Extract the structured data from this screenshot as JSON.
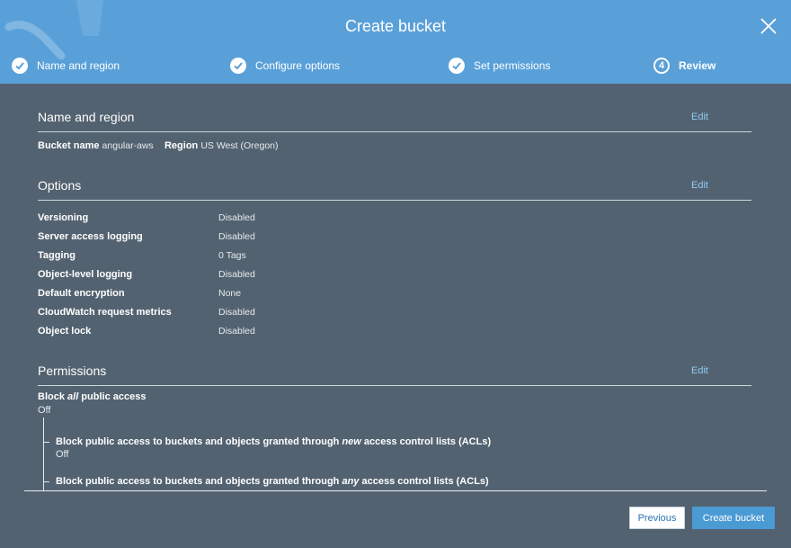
{
  "dialog": {
    "title": "Create bucket"
  },
  "steps": [
    {
      "label": "Name and region",
      "state": "done"
    },
    {
      "label": "Configure options",
      "state": "done"
    },
    {
      "label": "Set permissions",
      "state": "done"
    },
    {
      "number": "4",
      "label": "Review",
      "state": "active"
    }
  ],
  "name_region": {
    "heading": "Name and region",
    "edit": "Edit",
    "bucket_name_label": "Bucket name",
    "bucket_name_value": "angular-aws",
    "region_label": "Region",
    "region_value": "US West (Oregon)"
  },
  "options": {
    "heading": "Options",
    "edit": "Edit",
    "rows": [
      {
        "label": "Versioning",
        "value": "Disabled"
      },
      {
        "label": "Server access logging",
        "value": "Disabled"
      },
      {
        "label": "Tagging",
        "value": "0 Tags"
      },
      {
        "label": "Object-level logging",
        "value": "Disabled"
      },
      {
        "label": "Default encryption",
        "value": "None"
      },
      {
        "label": "CloudWatch request metrics",
        "value": "Disabled"
      },
      {
        "label": "Object lock",
        "value": "Disabled"
      }
    ]
  },
  "permissions": {
    "heading": "Permissions",
    "edit": "Edit",
    "block_all": {
      "prefix": "Block ",
      "em": "all",
      "suffix": " public access",
      "value": "Off"
    },
    "children": [
      {
        "prefix": "Block public access to buckets and objects granted through ",
        "em": "new",
        "suffix": " access control lists (ACLs)",
        "value": "Off"
      },
      {
        "prefix": "Block public access to buckets and objects granted through ",
        "em": "any",
        "suffix": " access control lists (ACLs)",
        "value": ""
      }
    ]
  },
  "footer": {
    "previous": "Previous",
    "create": "Create bucket"
  },
  "colors": {
    "header_bg": "#5aa0d8",
    "body_bg": "#536270",
    "link": "#8fcaf3",
    "primary_button": "#4a9ad4"
  },
  "icons": {
    "close": "close-icon",
    "step_done": "check-circle-icon"
  }
}
